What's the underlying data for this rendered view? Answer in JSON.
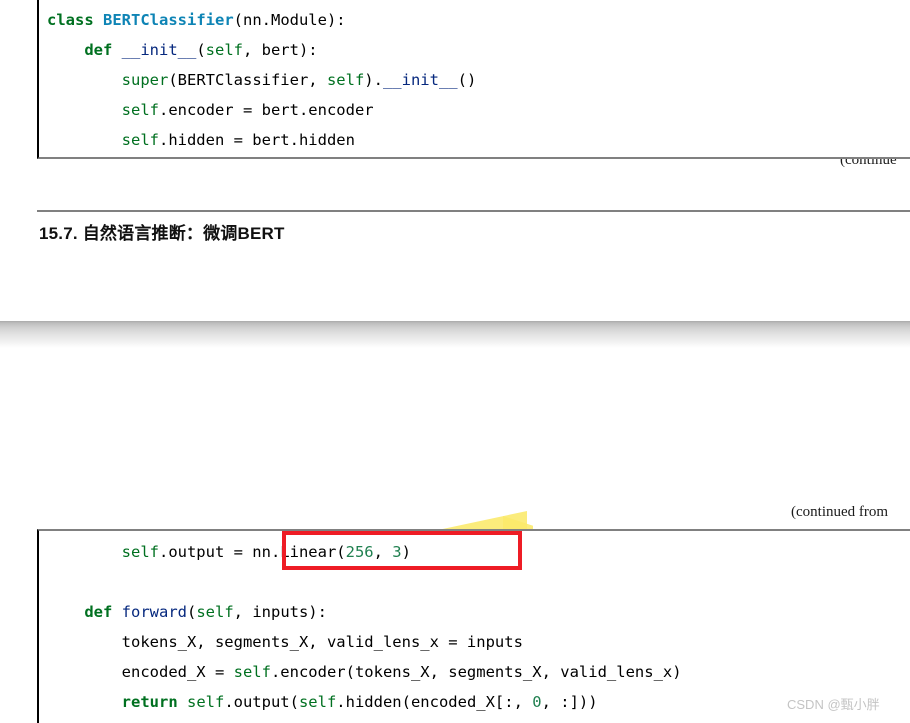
{
  "document": {
    "title": "15.7. 自然语言推断：微调BERT",
    "watermark": "CSDN @甄小胖",
    "continued_top": "(continue",
    "continued_bottom": "(continued from"
  },
  "code_block_1": {
    "name": "BERTClassifier class definition",
    "lines": [
      {
        "indent": 0,
        "tokens": [
          {
            "t": "class ",
            "c": "kw"
          },
          {
            "t": "BERTClassifier",
            "c": "cls"
          },
          {
            "t": "(nn.Module):",
            "c": "plain"
          }
        ]
      },
      {
        "indent": 1,
        "tokens": [
          {
            "t": "def ",
            "c": "kw"
          },
          {
            "t": "__init__",
            "c": "fn"
          },
          {
            "t": "(",
            "c": "plain"
          },
          {
            "t": "self",
            "c": "self"
          },
          {
            "t": ", bert):",
            "c": "plain"
          }
        ]
      },
      {
        "indent": 2,
        "tokens": [
          {
            "t": "super",
            "c": "self"
          },
          {
            "t": "(BERTClassifier, ",
            "c": "plain"
          },
          {
            "t": "self",
            "c": "self"
          },
          {
            "t": ").",
            "c": "plain"
          },
          {
            "t": "__init__",
            "c": "fn"
          },
          {
            "t": "()",
            "c": "plain"
          }
        ]
      },
      {
        "indent": 2,
        "tokens": [
          {
            "t": "self",
            "c": "self"
          },
          {
            "t": ".encoder = bert.encoder",
            "c": "plain"
          }
        ]
      },
      {
        "indent": 2,
        "tokens": [
          {
            "t": "self",
            "c": "self"
          },
          {
            "t": ".hidden = bert.hidden",
            "c": "plain"
          }
        ]
      }
    ]
  },
  "code_block_2": {
    "name": "BERTClassifier output layer and forward method",
    "lines": [
      {
        "indent": 2,
        "tokens": [
          {
            "t": "self",
            "c": "self"
          },
          {
            "t": ".output = nn.Linear(",
            "c": "plain"
          },
          {
            "t": "256",
            "c": "num"
          },
          {
            "t": ", ",
            "c": "plain"
          },
          {
            "t": "3",
            "c": "num"
          },
          {
            "t": ")",
            "c": "plain"
          }
        ]
      },
      {
        "indent": 0,
        "tokens": []
      },
      {
        "indent": 1,
        "tokens": [
          {
            "t": "def ",
            "c": "kw"
          },
          {
            "t": "forward",
            "c": "fn"
          },
          {
            "t": "(",
            "c": "plain"
          },
          {
            "t": "self",
            "c": "self"
          },
          {
            "t": ", inputs):",
            "c": "plain"
          }
        ]
      },
      {
        "indent": 2,
        "tokens": [
          {
            "t": "tokens_X, segments_X, valid_lens_x = inputs",
            "c": "plain"
          }
        ]
      },
      {
        "indent": 2,
        "tokens": [
          {
            "t": "encoded_X = ",
            "c": "plain"
          },
          {
            "t": "self",
            "c": "self"
          },
          {
            "t": ".encoder(tokens_X, segments_X, valid_lens_x)",
            "c": "plain"
          }
        ]
      },
      {
        "indent": 2,
        "tokens": [
          {
            "t": "return ",
            "c": "kw"
          },
          {
            "t": "self",
            "c": "self"
          },
          {
            "t": ".output(",
            "c": "plain"
          },
          {
            "t": "self",
            "c": "self"
          },
          {
            "t": ".hidden(encoded_X[:, ",
            "c": "plain"
          },
          {
            "t": "0",
            "c": "num"
          },
          {
            "t": ", :]))",
            "c": "plain"
          }
        ]
      }
    ]
  },
  "annotations": {
    "marker_color": "#fbe96a",
    "red_box_color": "#ee1c25",
    "highlighted_expression": "nn.Linear(256, 3)",
    "highlighted_line_1": "self.output = nn.Linear(256, 3)",
    "highlighted_fragment_2": "hidden(encoded_X[:, 0, :]))"
  },
  "colors": {
    "keyword": "#007020",
    "class_name": "#0e84b5",
    "function_name": "#06287e",
    "number": "#208050",
    "rule": "#808080",
    "watermark": "#c4c4c4"
  }
}
